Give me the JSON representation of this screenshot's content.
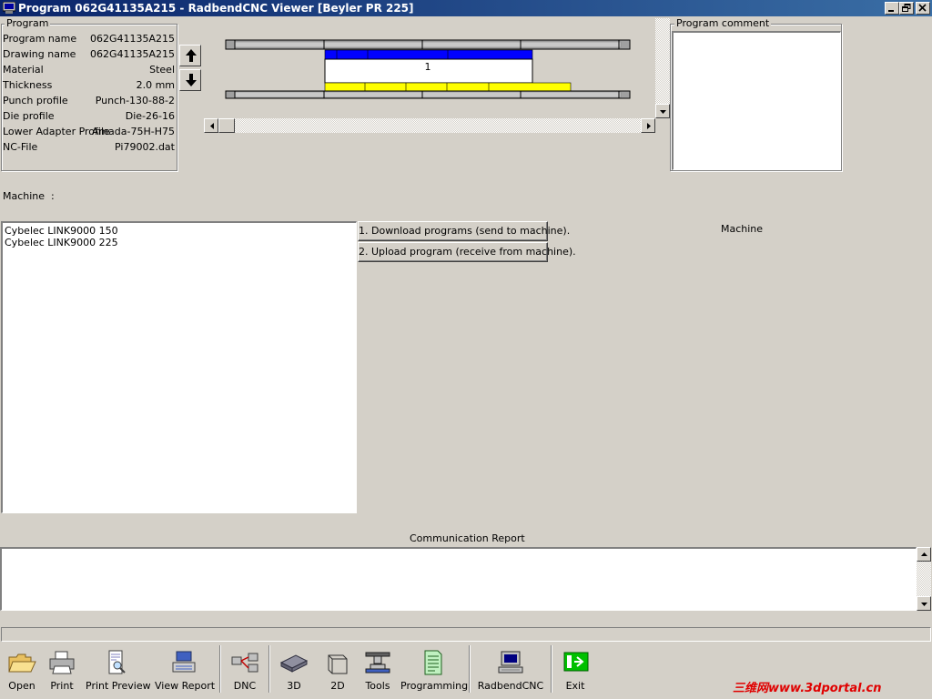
{
  "window": {
    "title": "Program 062G41135A215 - RadbendCNC Viewer [Beyler PR 225]"
  },
  "program_group": {
    "title": "Program",
    "rows": [
      {
        "label": "Program name",
        "value": "062G41135A215"
      },
      {
        "label": "Drawing name",
        "value": "062G41135A215"
      },
      {
        "label": "Material",
        "value": "Steel"
      },
      {
        "label": "Thickness",
        "value": "2.0 mm"
      },
      {
        "label": "Punch profile",
        "value": "Punch-130-88-2"
      },
      {
        "label": "Die profile",
        "value": "Die-26-16"
      },
      {
        "label": "Lower Adapter Profile",
        "value": "Amada-75H-H75"
      },
      {
        "label": "NC-File",
        "value": "Pi79002.dat"
      }
    ]
  },
  "diagram": {
    "station_label": "1",
    "colors": {
      "tooling_top": "#0000ff",
      "tooling_bottom": "#ffff00",
      "rail": "#a0a0a0"
    }
  },
  "comment_group": {
    "title": "Program comment",
    "text": ""
  },
  "machine_label": "Machine  :",
  "machine_list": [
    "Cybelec LINK9000 150",
    "Cybelec LINK9000 225"
  ],
  "buttons": {
    "download": "1. Download programs (send to machine).",
    "upload": "2. Upload program (receive from machine)."
  },
  "machine_heading": "Machine",
  "communication_report": {
    "title": "Communication Report",
    "text": ""
  },
  "toolbar": [
    {
      "id": "open",
      "label": "Open",
      "icon": "folder-open-icon"
    },
    {
      "id": "print",
      "label": "Print",
      "icon": "printer-icon"
    },
    {
      "id": "print-preview",
      "label": "Print Preview",
      "icon": "print-preview-icon"
    },
    {
      "id": "view-report",
      "label": "View Report",
      "icon": "report-icon"
    },
    {
      "id": "dnc",
      "label": "DNC",
      "icon": "network-icon"
    },
    {
      "id": "3d",
      "label": "3D",
      "icon": "3d-part-icon"
    },
    {
      "id": "2d",
      "label": "2D",
      "icon": "2d-part-icon"
    },
    {
      "id": "tools",
      "label": "Tools",
      "icon": "tools-icon"
    },
    {
      "id": "programming",
      "label": "Programming",
      "icon": "programming-icon"
    },
    {
      "id": "radbendcnc",
      "label": "RadbendCNC",
      "icon": "computer-icon"
    },
    {
      "id": "exit",
      "label": "Exit",
      "icon": "exit-icon"
    }
  ],
  "watermark": "三维网www.3dportal.cn"
}
